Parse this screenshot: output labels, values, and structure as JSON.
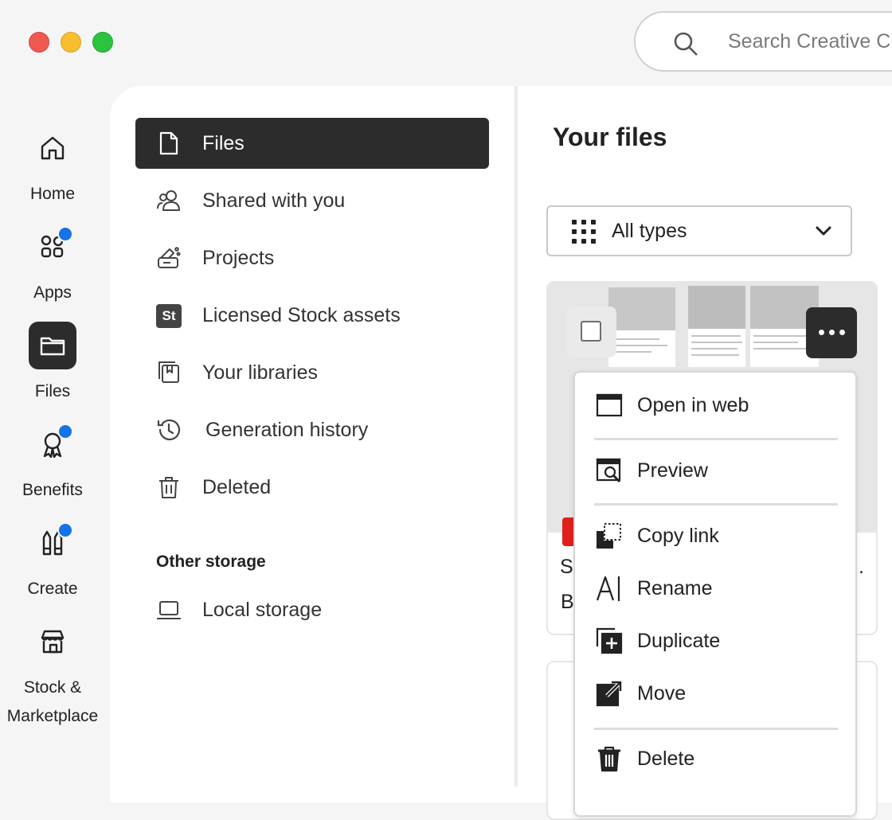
{
  "search": {
    "placeholder": "Search Creative Cl"
  },
  "rail": {
    "items": [
      {
        "label": "Home",
        "icon": "home-icon",
        "notify": false
      },
      {
        "label": "Apps",
        "icon": "apps-icon",
        "notify": true
      },
      {
        "label": "Files",
        "icon": "folder-icon",
        "notify": false,
        "active": true
      },
      {
        "label": "Benefits",
        "icon": "ribbon-icon",
        "notify": true
      },
      {
        "label": "Create",
        "icon": "pencils-icon",
        "notify": true
      },
      {
        "label": "Stock & Marketplace",
        "label_line1": "Stock &",
        "label_line2": "Marketplace",
        "icon": "storefront-icon",
        "notify": false
      }
    ]
  },
  "nav": {
    "items": [
      {
        "label": "Files",
        "icon": "file-icon",
        "active": true
      },
      {
        "label": "Shared with you",
        "icon": "shared-users-icon"
      },
      {
        "label": "Projects",
        "icon": "projects-icon"
      },
      {
        "label": "Licensed Stock assets",
        "icon": "stock-badge-icon",
        "badge": "St"
      },
      {
        "label": "Your libraries",
        "icon": "libraries-icon"
      },
      {
        "label": "Generation history",
        "icon": "history-icon"
      },
      {
        "label": "Deleted",
        "icon": "trash-icon"
      }
    ],
    "other_storage_heading": "Other storage",
    "other_storage": [
      {
        "label": "Local storage",
        "icon": "laptop-icon"
      }
    ]
  },
  "main": {
    "title": "Your files",
    "type_filter": {
      "value": "All types",
      "icon": "grid-icon"
    },
    "card": {
      "name_start": "S",
      "name_end": ".",
      "meta_start": "B"
    }
  },
  "context_menu": {
    "items": [
      {
        "label": "Open in web",
        "icon": "browser-window-icon"
      },
      {
        "label": "Preview",
        "icon": "preview-icon"
      },
      {
        "label": "Copy link",
        "icon": "copy-link-icon"
      },
      {
        "label": "Rename",
        "icon": "rename-icon"
      },
      {
        "label": "Duplicate",
        "icon": "duplicate-icon"
      },
      {
        "label": "Move",
        "icon": "move-icon"
      },
      {
        "label": "Delete",
        "icon": "trash-icon"
      }
    ]
  },
  "colors": {
    "accent": "#1473e6",
    "active_bg": "#2c2c2c",
    "pdf_red": "#e0201c"
  }
}
